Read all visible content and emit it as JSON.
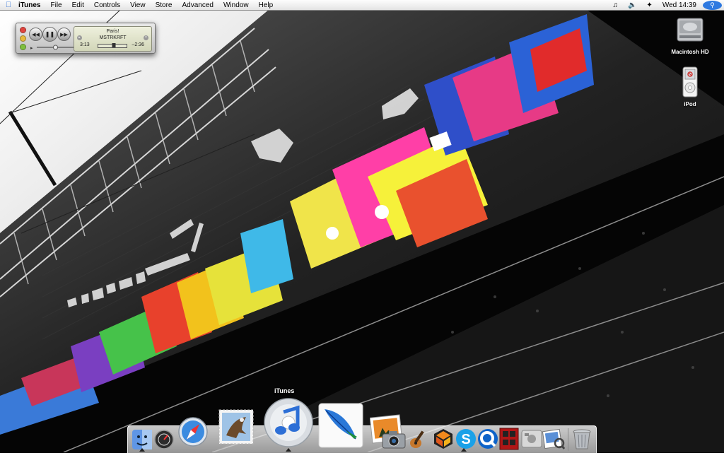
{
  "menubar": {
    "app_name": "iTunes",
    "menus": [
      "File",
      "Edit",
      "Controls",
      "View",
      "Store",
      "Advanced",
      "Window",
      "Help"
    ],
    "status_icons": [
      "music-note-icon",
      "volume-icon",
      "bluetooth-icon"
    ],
    "clock": "Wed 14:39",
    "spotlight_icon": "spotlight-icon"
  },
  "mini_player": {
    "song": "Paris!",
    "artist": "MSTRKRFT",
    "elapsed": "3:13",
    "remaining": "–2:36",
    "progress": 0.55,
    "volume": 0.5,
    "traffic_lights": [
      "#e0443e",
      "#e6b93b",
      "#7fbf3f"
    ]
  },
  "desktop_icons": [
    {
      "label": "Macintosh HD",
      "icon": "hard-drive-icon"
    },
    {
      "label": "iPod",
      "icon": "ipod-icon"
    }
  ],
  "dock": {
    "hover_label": "iTunes",
    "apps": [
      {
        "name": "Finder",
        "icon": "finder-icon"
      },
      {
        "name": "Dashboard",
        "icon": "dashboard-icon"
      },
      {
        "name": "Safari",
        "icon": "safari-icon"
      },
      {
        "name": "Mail",
        "icon": "mail-icon"
      },
      {
        "name": "iTunes",
        "icon": "itunes-icon"
      },
      {
        "name": "Feather",
        "icon": "feather-icon"
      },
      {
        "name": "iPhoto",
        "icon": "iphoto-icon"
      },
      {
        "name": "Image Capture",
        "icon": "camera-icon"
      },
      {
        "name": "GarageBand",
        "icon": "guitar-icon"
      },
      {
        "name": "Reason",
        "icon": "reason-icon"
      },
      {
        "name": "Skype",
        "icon": "skype-icon"
      },
      {
        "name": "QuickTime",
        "icon": "quicktime-icon"
      },
      {
        "name": "Photo Booth",
        "icon": "photo-booth-icon"
      },
      {
        "name": "System Preferences",
        "icon": "apple-prefs-icon"
      },
      {
        "name": "Preview",
        "icon": "preview-icon"
      },
      {
        "name": "Trash",
        "icon": "trash-icon"
      }
    ]
  },
  "colors": {
    "menubar": "#ececec",
    "spotlight": "#2e79e0",
    "lcd": "#e3e6cb"
  }
}
